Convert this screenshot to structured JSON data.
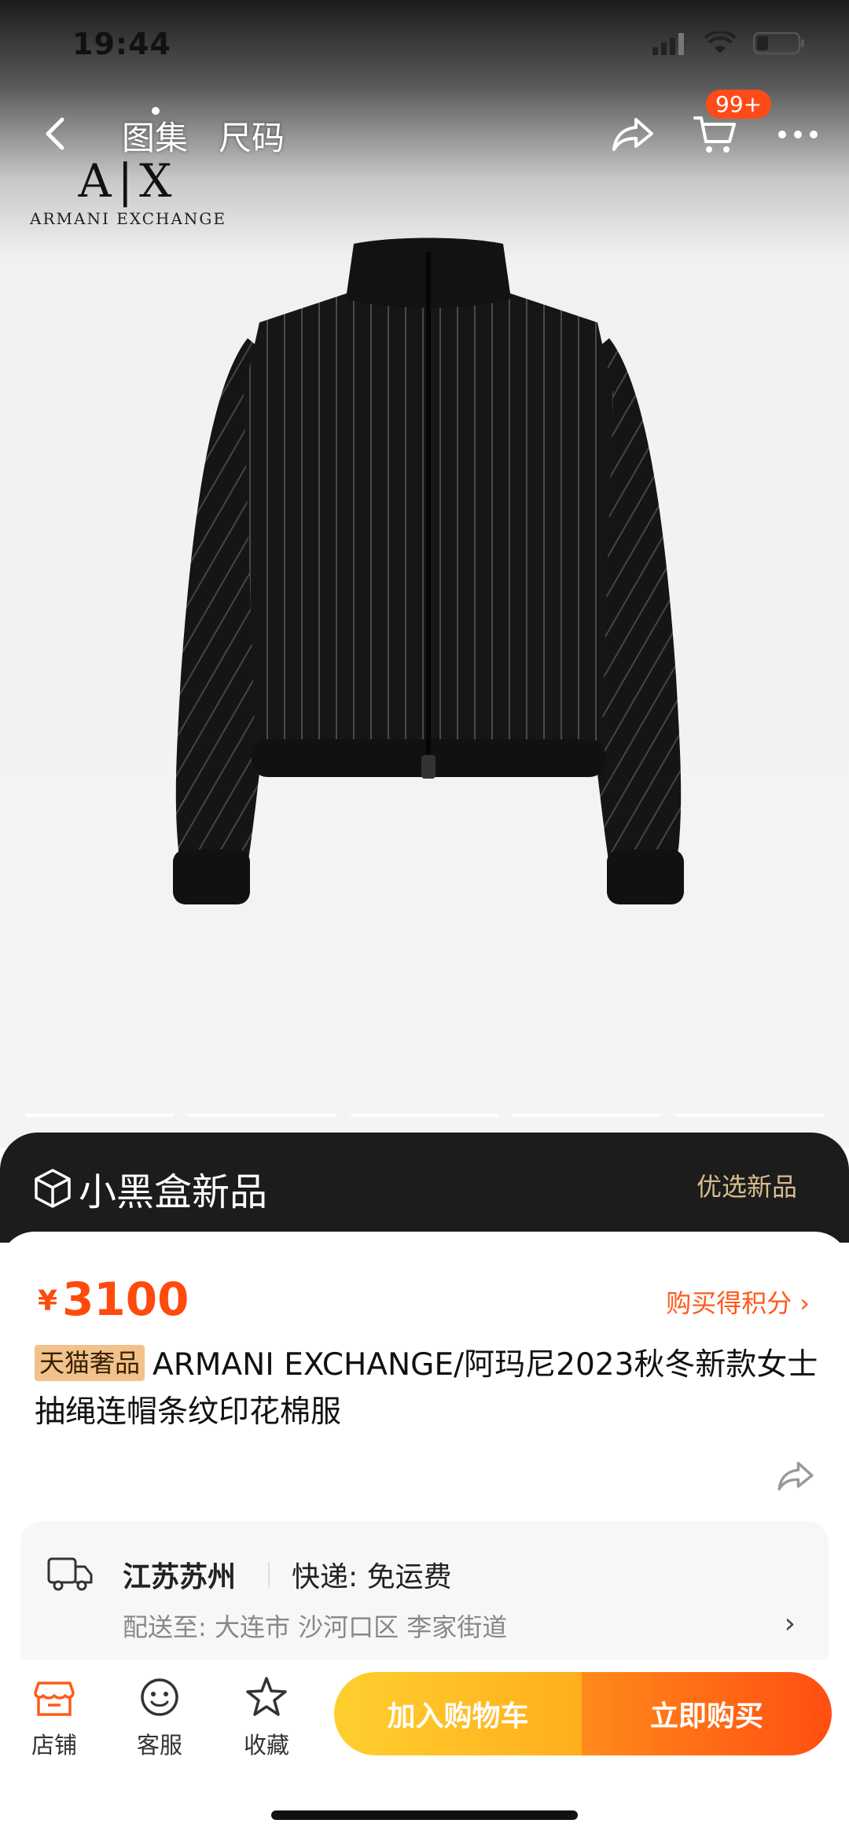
{
  "status_bar": {
    "time": "19:44"
  },
  "nav": {
    "tabs": [
      {
        "label": "图集"
      },
      {
        "label": "尺码"
      }
    ],
    "cart_badge": "99+"
  },
  "brand": {
    "mark": "A|X",
    "name": "ARMANI EXCHANGE"
  },
  "gallery": {
    "slides": 5,
    "active_slide": 0
  },
  "banner": {
    "title": "小黑盒新品",
    "right_label": "优选新品"
  },
  "product": {
    "price_symbol": "¥",
    "price": "3100",
    "points_label": "购买得积分",
    "tag": "天猫奢品",
    "title": "ARMANI EXCHANGE/阿玛尼2023秋冬新款女士抽绳连帽条纹印花棉服"
  },
  "delivery": {
    "origin": "江苏苏州",
    "express": "快递: 免运费",
    "deliver_to": "配送至: 大连市 沙河口区 李家街道"
  },
  "bottom_bar": {
    "store_label": "店铺",
    "service_label": "客服",
    "favorite_label": "收藏",
    "add_to_cart": "加入购物车",
    "buy_now": "立即购买"
  },
  "colors": {
    "accent_orange": "#ff4a0e",
    "cart_button": "#ffbf24",
    "buy_button": "#ff5a14",
    "banner_bg": "#1c1c1c",
    "banner_gold": "#d8bc8c",
    "tag_bg": "#f2c28c"
  },
  "icons": [
    "back-icon",
    "share-icon",
    "cart-icon",
    "more-icon",
    "cube-icon",
    "truck-icon",
    "chevron-right-icon",
    "store-icon",
    "service-icon",
    "star-icon"
  ]
}
